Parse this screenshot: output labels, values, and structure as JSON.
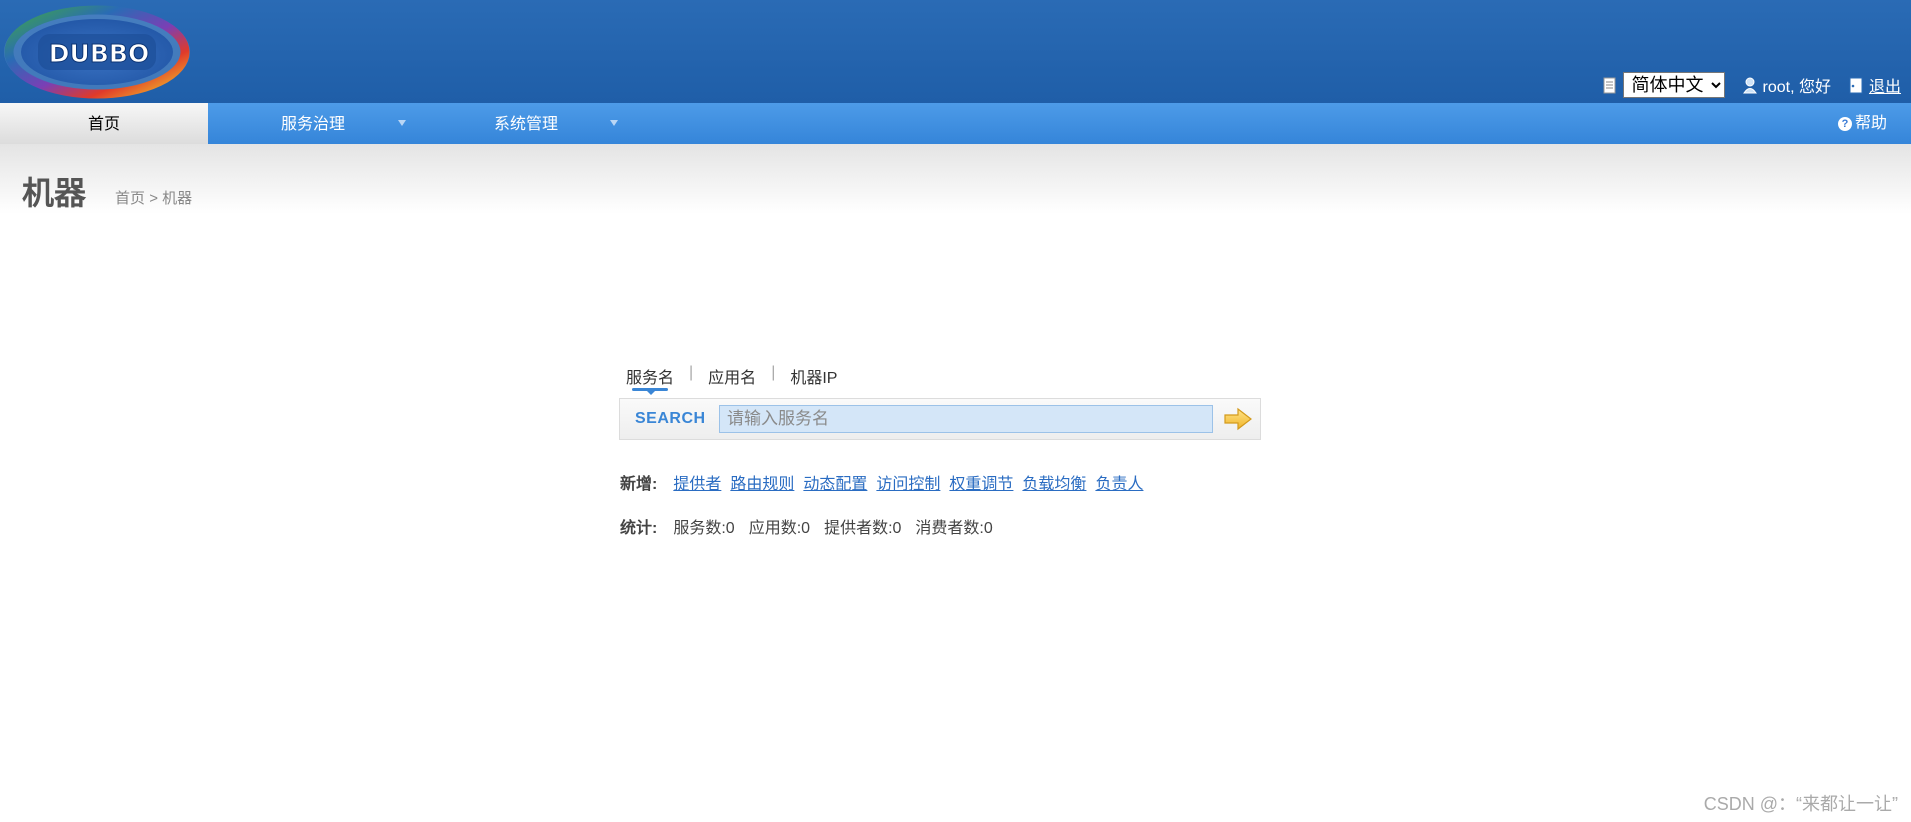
{
  "header": {
    "logo_text": "DUBBO",
    "language": {
      "selected": "简体中文",
      "options": [
        "简体中文"
      ]
    },
    "user_greeting": "root, 您好",
    "logout": "退出"
  },
  "nav": {
    "home": "首页",
    "menus": [
      {
        "label": "服务治理"
      },
      {
        "label": "系统管理"
      }
    ],
    "help": "帮助"
  },
  "page": {
    "title": "机器",
    "breadcrumb": {
      "home": "首页",
      "sep": ">",
      "current": "机器"
    }
  },
  "search": {
    "tabs": [
      "服务名",
      "应用名",
      "机器IP"
    ],
    "tab_separator": "|",
    "active_tab": "服务名",
    "label": "SEARCH",
    "placeholder": "请输入服务名",
    "value": ""
  },
  "add": {
    "label": "新增:",
    "links": [
      "提供者",
      "路由规则",
      "动态配置",
      "访问控制",
      "权重调节",
      "负载均衡",
      "负责人"
    ]
  },
  "stats": {
    "label": "统计:",
    "items": [
      "服务数:0",
      "应用数:0",
      "提供者数:0",
      "消费者数:0"
    ]
  },
  "watermark": "CSDN @：“来都让一让”",
  "colors": {
    "header_bg": "#1f5ea8",
    "nav_bg": "#3585d9",
    "accent": "#3a86d6",
    "link": "#2a6cc2"
  }
}
